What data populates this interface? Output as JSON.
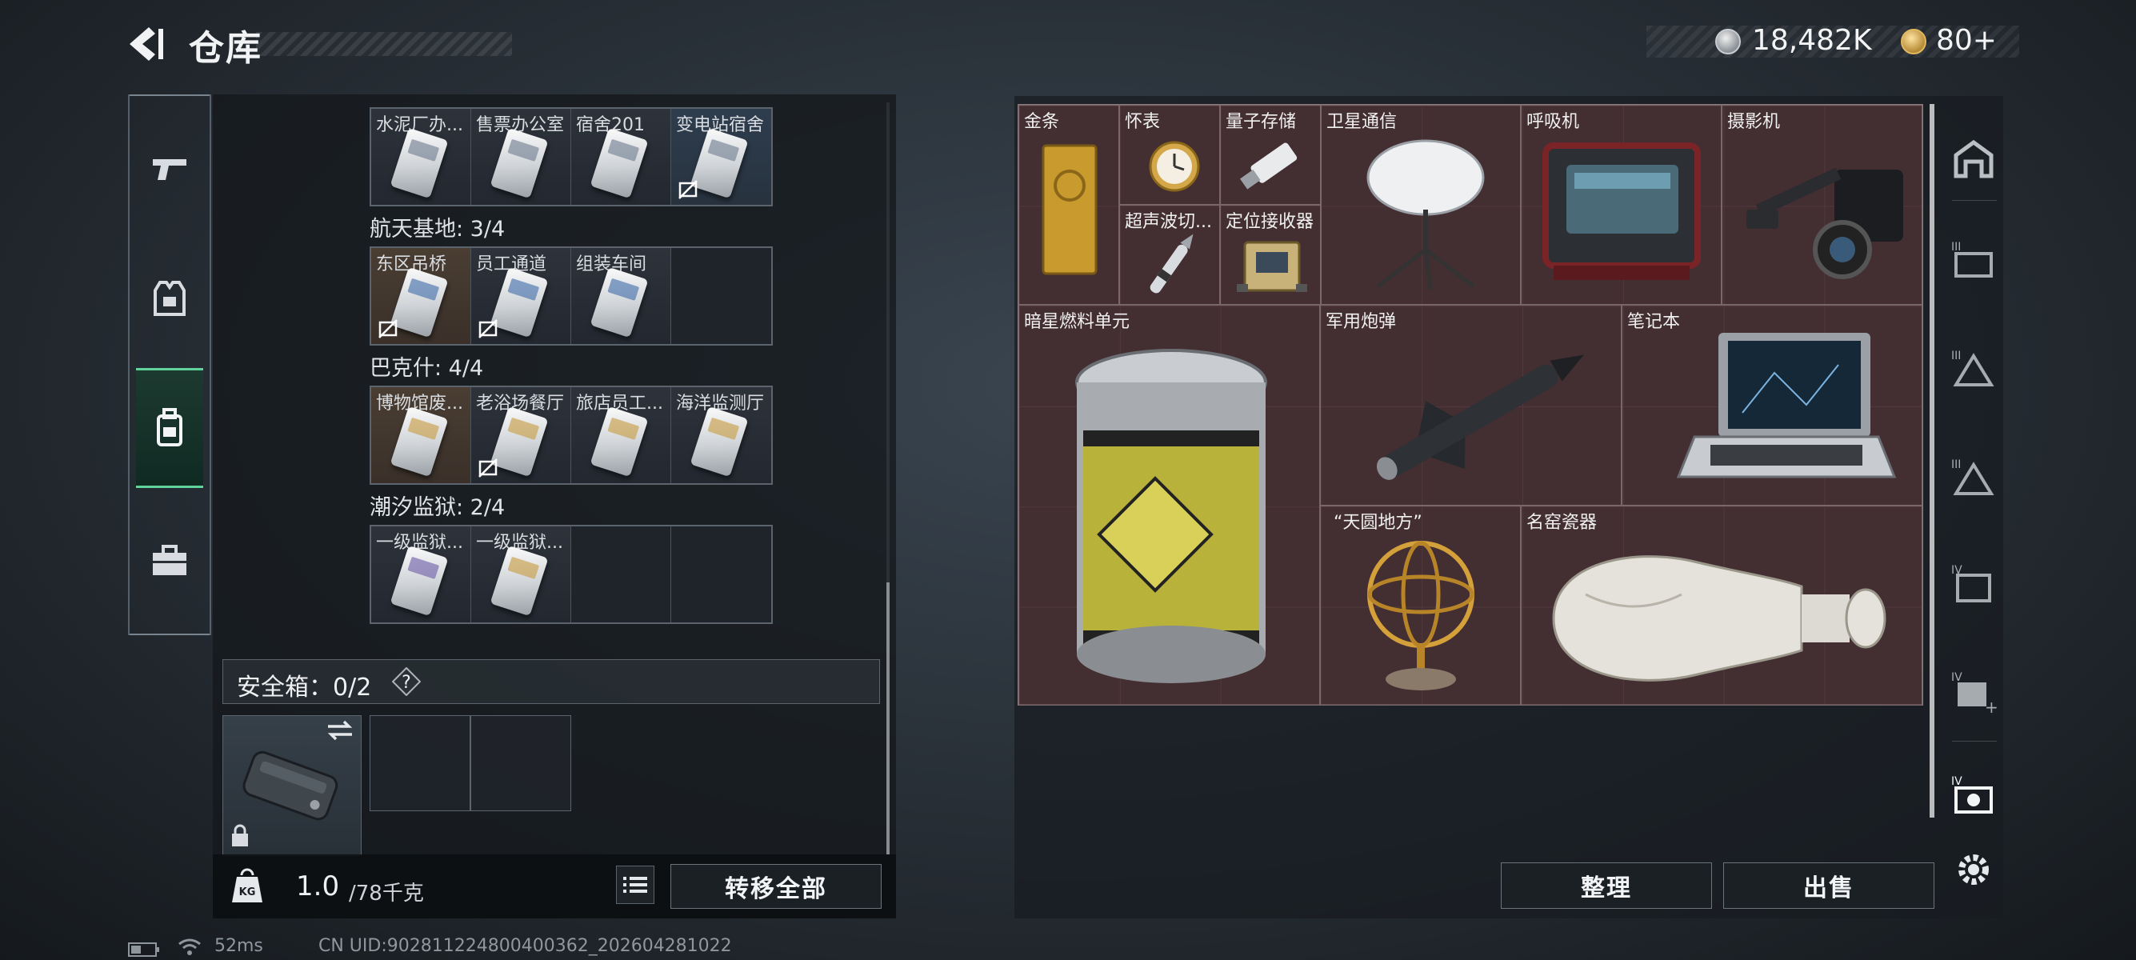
{
  "header": {
    "title": "仓库",
    "currency_silver": "18,482K",
    "currency_gold": "80+",
    "icons": [
      "back-arrow-icon",
      "silver-coin-icon",
      "gold-coin-icon"
    ]
  },
  "left_tabs": [
    {
      "name": "weapons-tab",
      "icon": "pistol-icon"
    },
    {
      "name": "armor-tab",
      "icon": "vest-icon"
    },
    {
      "name": "backpack-tab",
      "icon": "backpack-icon",
      "active": true
    },
    {
      "name": "toolbox-tab",
      "icon": "briefcase-icon"
    }
  ],
  "key_groups": [
    {
      "title": "",
      "slots": [
        {
          "label": "水泥厂办...",
          "tint": "gray",
          "card": "gray"
        },
        {
          "label": "售票办公室",
          "tint": "gray",
          "card": "gray"
        },
        {
          "label": "宿舍201",
          "tint": "gray",
          "card": "gray"
        },
        {
          "label": "变电站宿舍",
          "tint": "bluish",
          "card": "gray",
          "no_sell": true
        }
      ]
    },
    {
      "title": "航天基地: 3/4",
      "slots": [
        {
          "label": "东区吊桥",
          "tint": "brown",
          "card": "blue",
          "no_sell": true
        },
        {
          "label": "员工通道",
          "tint": "gray",
          "card": "blue",
          "no_sell": true
        },
        {
          "label": "组装车间",
          "tint": "gray",
          "card": "blue"
        },
        {
          "label": "",
          "tint": "empty"
        }
      ]
    },
    {
      "title": "巴克什: 4/4",
      "slots": [
        {
          "label": "博物馆废...",
          "tint": "brown",
          "card": "gold"
        },
        {
          "label": "老浴场餐厅",
          "tint": "gray",
          "card": "gold",
          "no_sell": true
        },
        {
          "label": "旅店员工...",
          "tint": "gray",
          "card": "gold"
        },
        {
          "label": "海洋监测厅",
          "tint": "gray",
          "card": "gold"
        }
      ]
    },
    {
      "title": "潮汐监狱: 2/4",
      "slots": [
        {
          "label": "一级监狱...",
          "tint": "gray",
          "card": "purple"
        },
        {
          "label": "一级监狱...",
          "tint": "gray",
          "card": "gold"
        },
        {
          "label": "",
          "tint": "empty"
        },
        {
          "label": "",
          "tint": "empty"
        }
      ]
    }
  ],
  "safebox": {
    "label": "安全箱：0/2",
    "help": "?"
  },
  "footer_left": {
    "weight_current": "1.0",
    "weight_capacity": "/78千克",
    "transfer_all": "转移全部"
  },
  "stash_items": [
    {
      "id": "gold-bar",
      "label": "金条"
    },
    {
      "id": "pocket-watch",
      "label": "怀表"
    },
    {
      "id": "quantum-storage",
      "label": "量子存储"
    },
    {
      "id": "satellite-comm",
      "label": "卫星通信"
    },
    {
      "id": "ventilator",
      "label": "呼吸机"
    },
    {
      "id": "camera",
      "label": "摄影机"
    },
    {
      "id": "ultrasonic-cutter",
      "label": "超声波切..."
    },
    {
      "id": "locator-receiver",
      "label": "定位接收器"
    },
    {
      "id": "fuel-cell",
      "label": "暗星燃料单元"
    },
    {
      "id": "missile",
      "label": "军用炮弹"
    },
    {
      "id": "laptop",
      "label": "笔记本"
    },
    {
      "id": "armillary-sphere",
      "label": "“天圆地方”"
    },
    {
      "id": "porcelain",
      "label": "名窑瓷器"
    }
  ],
  "actions": {
    "sort": "整理",
    "sell": "出售"
  },
  "status": {
    "ping": "52ms",
    "uid": "CN UID:902811224800400362_202604281022"
  },
  "colors": {
    "stash_bg": "#3d2a2e",
    "active_tab": "#5fd39a",
    "panel": "#14181c"
  }
}
